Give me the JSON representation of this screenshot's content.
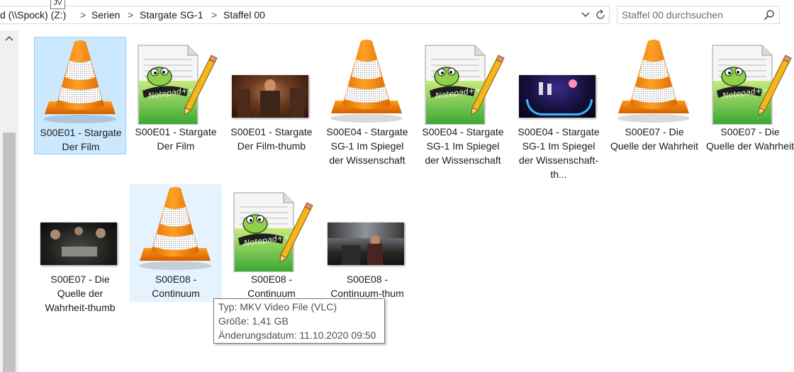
{
  "breadcrumb": {
    "items": [
      "d (\\\\Spock) (Z:)",
      "Serien",
      "Stargate SG-1",
      "Staffel 00"
    ],
    "separator": ">"
  },
  "search": {
    "placeholder": "Staffel 00 durchsuchen"
  },
  "overlay_tooltip": {
    "text": "JV"
  },
  "files": [
    {
      "label": "S00E01 - Stargate Der Film",
      "icon": "vlc-cone-icon",
      "state": "selected"
    },
    {
      "label": "S00E01 - Stargate Der Film",
      "icon": "notepadpp-file-icon",
      "state": "normal"
    },
    {
      "label": "S00E01 - Stargate Der Film-thumb",
      "icon": "image-thumbnail",
      "state": "normal"
    },
    {
      "label": "S00E04 - Stargate SG-1 Im Spiegel der Wissenschaft",
      "icon": "vlc-cone-icon",
      "state": "normal"
    },
    {
      "label": "S00E04 - Stargate SG-1 Im Spiegel der Wissenschaft",
      "icon": "notepadpp-file-icon",
      "state": "normal"
    },
    {
      "label": "S00E04 - Stargate SG-1 Im Spiegel der Wissenschaft-th...",
      "icon": "image-thumbnail",
      "state": "normal"
    },
    {
      "label": "S00E07 - Die Quelle der Wahrheit",
      "icon": "vlc-cone-icon",
      "state": "normal"
    },
    {
      "label": "S00E07 - Die Quelle der Wahrheit",
      "icon": "notepadpp-file-icon",
      "state": "normal"
    },
    {
      "label": "S00E07 - Die Quelle der Wahrheit-thumb",
      "icon": "image-thumbnail",
      "state": "normal"
    },
    {
      "label": "S00E08 - Continuum",
      "icon": "vlc-cone-icon",
      "state": "hover"
    },
    {
      "label": "S00E08 - Continuum",
      "icon": "notepadpp-file-icon",
      "state": "normal"
    },
    {
      "label": "S00E08 - Continuum-thum",
      "icon": "image-thumbnail",
      "state": "normal"
    }
  ],
  "tooltip": {
    "type": "Typ: MKV Video File (VLC)",
    "size": "Größe: 1,41 GB",
    "modified": "Änderungsdatum: 11.10.2020 09:50"
  },
  "colors": {
    "selection_bg": "#cce8ff",
    "hover_bg": "#e5f3ff",
    "vlc_orange": "#f08a00"
  }
}
